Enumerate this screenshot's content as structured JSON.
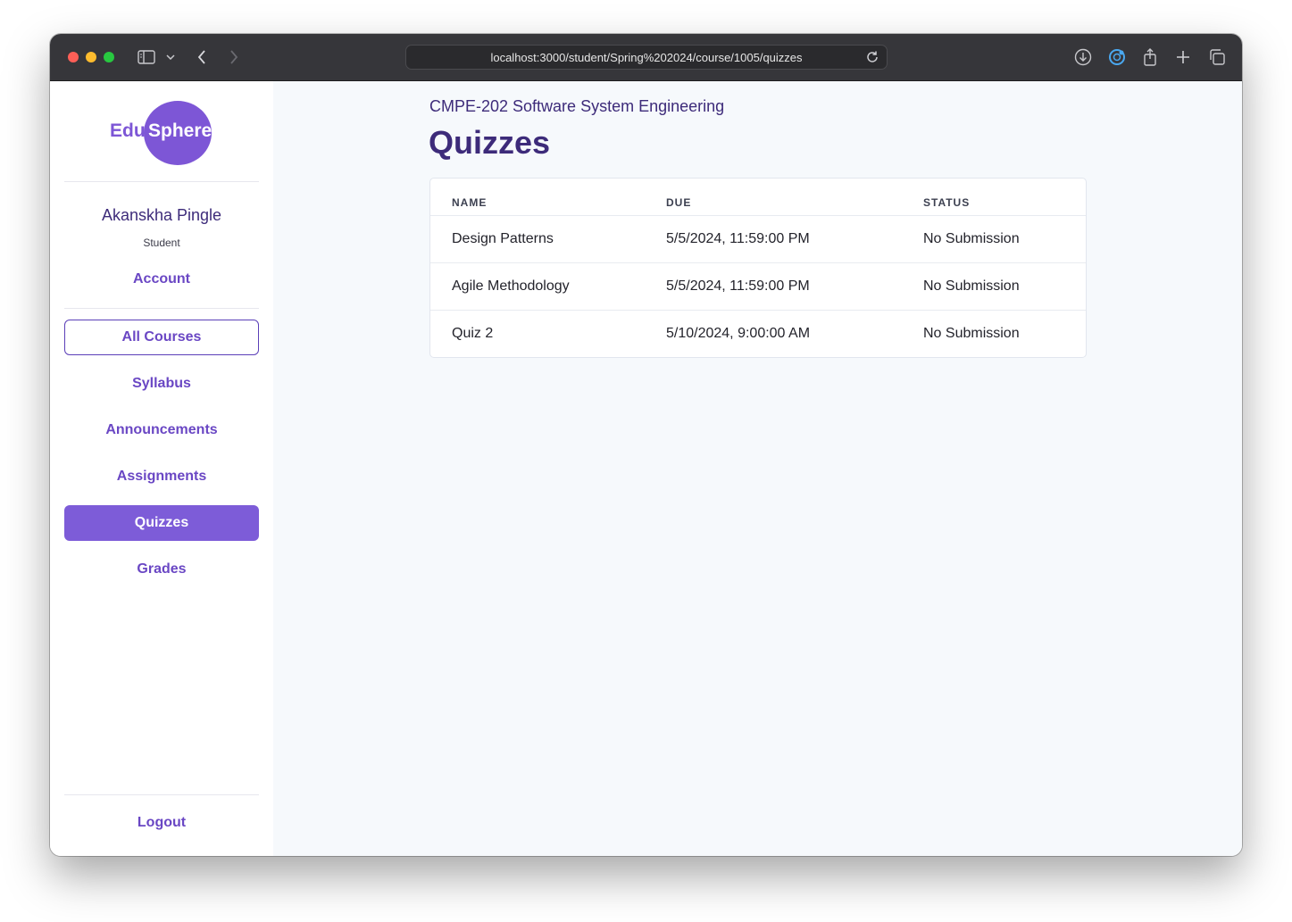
{
  "browser": {
    "url": "localhost:3000/student/Spring%202024/course/1005/quizzes"
  },
  "sidebar": {
    "logo": {
      "edu": "Edu",
      "sphere": "Sphere"
    },
    "user_name": "Akanskha Pingle",
    "user_role": "Student",
    "account_label": "Account",
    "nav": {
      "all_courses": "All Courses",
      "syllabus": "Syllabus",
      "announcements": "Announcements",
      "assignments": "Assignments",
      "quizzes": "Quizzes",
      "grades": "Grades"
    },
    "logout_label": "Logout"
  },
  "main": {
    "course_title": "CMPE-202 Software System Engineering",
    "page_title": "Quizzes",
    "table": {
      "headers": [
        "NAME",
        "DUE",
        "STATUS"
      ],
      "rows": [
        {
          "name": "Design Patterns",
          "due": "5/5/2024, 11:59:00 PM",
          "status": "No Submission"
        },
        {
          "name": "Agile Methodology",
          "due": "5/5/2024, 11:59:00 PM",
          "status": "No Submission"
        },
        {
          "name": "Quiz 2",
          "due": "5/10/2024, 9:00:00 AM",
          "status": "No Submission"
        }
      ]
    }
  },
  "colors": {
    "accent": "#7d56d6",
    "title_text": "#3d2b7a",
    "main_bg": "#f6f9fc"
  }
}
